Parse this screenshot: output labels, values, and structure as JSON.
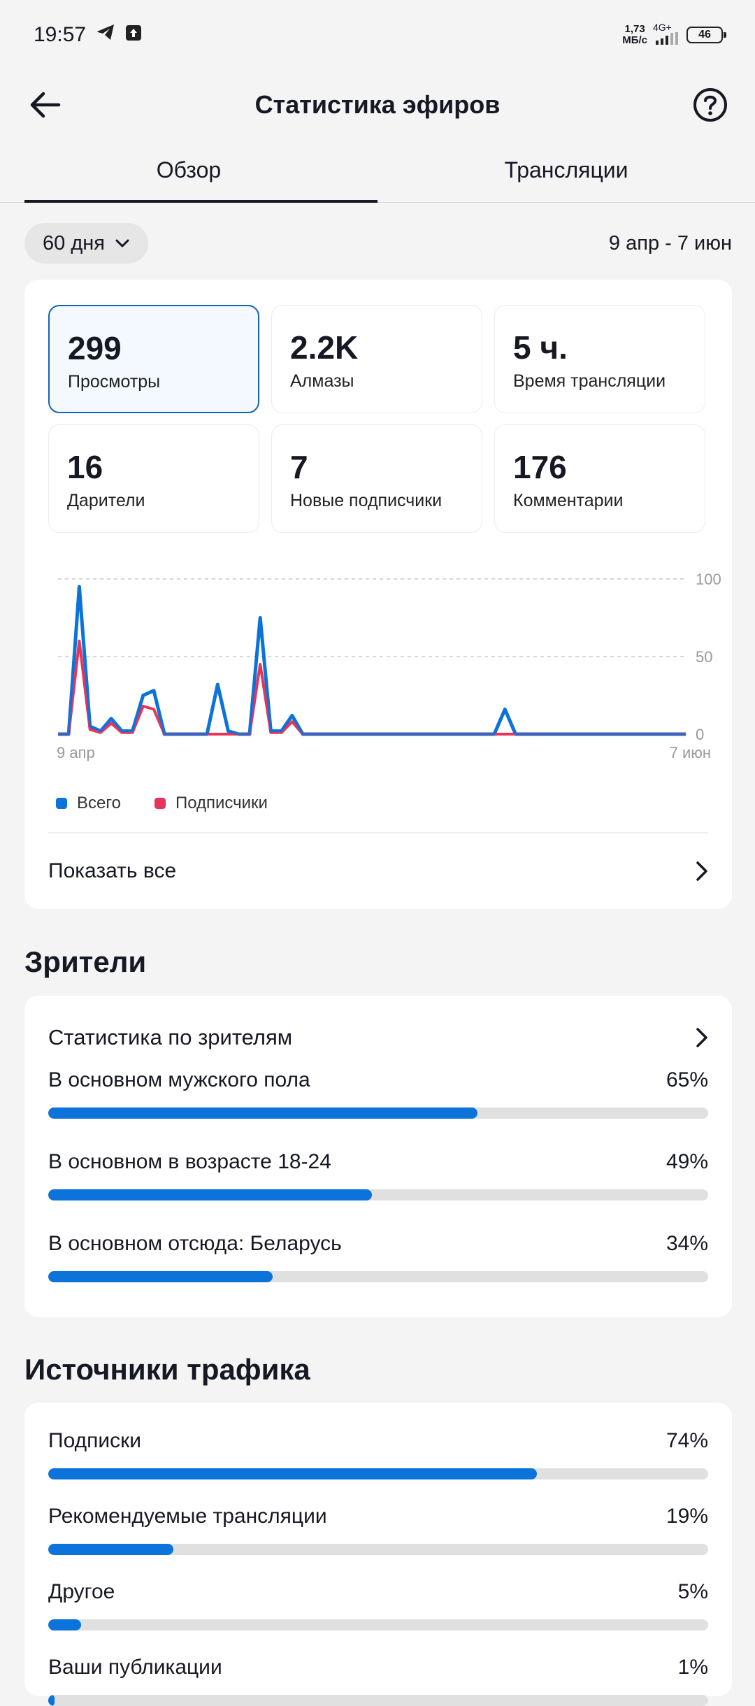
{
  "status_bar": {
    "time": "19:57",
    "net_speed": "1,73",
    "net_unit": "МБ/с",
    "net_type": "4G+",
    "battery": "46"
  },
  "header": {
    "title": "Статистика эфиров",
    "back_icon": "arrow-left-icon",
    "help_icon": "help-circle-icon"
  },
  "tabs": [
    {
      "label": "Обзор",
      "active": true
    },
    {
      "label": "Трансляции",
      "active": false
    }
  ],
  "filter": {
    "range_label": "60 дня",
    "date_range": "9 апр - 7 июн"
  },
  "metrics": [
    {
      "value": "299",
      "label": "Просмотры",
      "selected": true
    },
    {
      "value": "2.2K",
      "label": "Алмазы",
      "selected": false
    },
    {
      "value": "5 ч.",
      "label": "Время трансляции",
      "selected": false
    },
    {
      "value": "16",
      "label": "Дарители",
      "selected": false
    },
    {
      "value": "7",
      "label": "Новые подписчики",
      "selected": false
    },
    {
      "value": "176",
      "label": "Комментарии",
      "selected": false
    }
  ],
  "chart_data": {
    "type": "line",
    "x_start_label": "9 апр",
    "x_end_label": "7 июн",
    "ylim": [
      0,
      100
    ],
    "yticks": [
      "100",
      "50",
      "0"
    ],
    "grid": true,
    "legend_position": "bottom-left",
    "series": [
      {
        "name": "Всего",
        "color": "#0b73d9",
        "values": [
          0,
          0,
          95,
          5,
          2,
          10,
          2,
          2,
          25,
          28,
          0,
          0,
          0,
          0,
          0,
          32,
          2,
          0,
          0,
          75,
          2,
          2,
          12,
          0,
          0,
          0,
          0,
          0,
          0,
          0,
          0,
          0,
          0,
          0,
          0,
          0,
          0,
          0,
          0,
          0,
          0,
          0,
          16,
          0,
          0,
          0,
          0,
          0,
          0,
          0,
          0,
          0,
          0,
          0,
          0,
          0,
          0,
          0,
          0,
          0
        ]
      },
      {
        "name": "Подписчики",
        "color": "#e8345a",
        "values": [
          0,
          0,
          60,
          3,
          1,
          7,
          1,
          1,
          18,
          16,
          0,
          0,
          0,
          0,
          0,
          0,
          0,
          0,
          0,
          45,
          1,
          1,
          8,
          0,
          0,
          0,
          0,
          0,
          0,
          0,
          0,
          0,
          0,
          0,
          0,
          0,
          0,
          0,
          0,
          0,
          0,
          0,
          0,
          0,
          0,
          0,
          0,
          0,
          0,
          0,
          0,
          0,
          0,
          0,
          0,
          0,
          0,
          0,
          0,
          0
        ]
      }
    ]
  },
  "show_all": "Показать все",
  "viewers": {
    "section_title": "Зрители",
    "card_title": "Статистика по зрителям",
    "rows": [
      {
        "label": "В основном мужского пола",
        "percent_text": "65%",
        "value": 65
      },
      {
        "label": "В основном в возрасте 18-24",
        "percent_text": "49%",
        "value": 49
      },
      {
        "label": "В основном отсюда: Беларусь",
        "percent_text": "34%",
        "value": 34
      }
    ]
  },
  "traffic": {
    "section_title": "Источники трафика",
    "rows": [
      {
        "label": "Подписки",
        "percent_text": "74%",
        "value": 74
      },
      {
        "label": "Рекомендуемые трансляции",
        "percent_text": "19%",
        "value": 19
      },
      {
        "label": "Другое",
        "percent_text": "5%",
        "value": 5
      },
      {
        "label": "Ваши публикации",
        "percent_text": "1%",
        "value": 1
      }
    ]
  },
  "colors": {
    "accent": "#0b73d9",
    "secondary": "#e8345a",
    "track": "#e0e0e0"
  }
}
